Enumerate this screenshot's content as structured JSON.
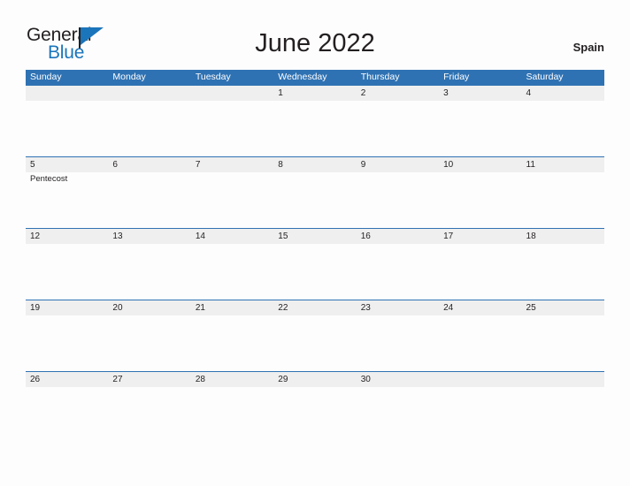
{
  "brand": {
    "name_part1": "General",
    "name_part2": "Blue",
    "color_primary": "#1b75bb",
    "color_text": "#231f20",
    "flag_icon": "triangle-flag-icon"
  },
  "header": {
    "title": "June 2022",
    "locale": "Spain"
  },
  "calendar": {
    "month": "June",
    "year": "2022",
    "header_bg": "#2f72b3",
    "date_band_bg": "#efefef",
    "weekday_headers": [
      "Sunday",
      "Monday",
      "Tuesday",
      "Wednesday",
      "Thursday",
      "Friday",
      "Saturday"
    ],
    "weeks": [
      {
        "days": [
          {
            "date": "",
            "events": []
          },
          {
            "date": "",
            "events": []
          },
          {
            "date": "",
            "events": []
          },
          {
            "date": "1",
            "events": []
          },
          {
            "date": "2",
            "events": []
          },
          {
            "date": "3",
            "events": []
          },
          {
            "date": "4",
            "events": []
          }
        ]
      },
      {
        "days": [
          {
            "date": "5",
            "events": [
              "Pentecost"
            ]
          },
          {
            "date": "6",
            "events": []
          },
          {
            "date": "7",
            "events": []
          },
          {
            "date": "8",
            "events": []
          },
          {
            "date": "9",
            "events": []
          },
          {
            "date": "10",
            "events": []
          },
          {
            "date": "11",
            "events": []
          }
        ]
      },
      {
        "days": [
          {
            "date": "12",
            "events": []
          },
          {
            "date": "13",
            "events": []
          },
          {
            "date": "14",
            "events": []
          },
          {
            "date": "15",
            "events": []
          },
          {
            "date": "16",
            "events": []
          },
          {
            "date": "17",
            "events": []
          },
          {
            "date": "18",
            "events": []
          }
        ]
      },
      {
        "days": [
          {
            "date": "19",
            "events": []
          },
          {
            "date": "20",
            "events": []
          },
          {
            "date": "21",
            "events": []
          },
          {
            "date": "22",
            "events": []
          },
          {
            "date": "23",
            "events": []
          },
          {
            "date": "24",
            "events": []
          },
          {
            "date": "25",
            "events": []
          }
        ]
      },
      {
        "days": [
          {
            "date": "26",
            "events": []
          },
          {
            "date": "27",
            "events": []
          },
          {
            "date": "28",
            "events": []
          },
          {
            "date": "29",
            "events": []
          },
          {
            "date": "30",
            "events": []
          },
          {
            "date": "",
            "events": []
          },
          {
            "date": "",
            "events": []
          }
        ]
      }
    ]
  }
}
